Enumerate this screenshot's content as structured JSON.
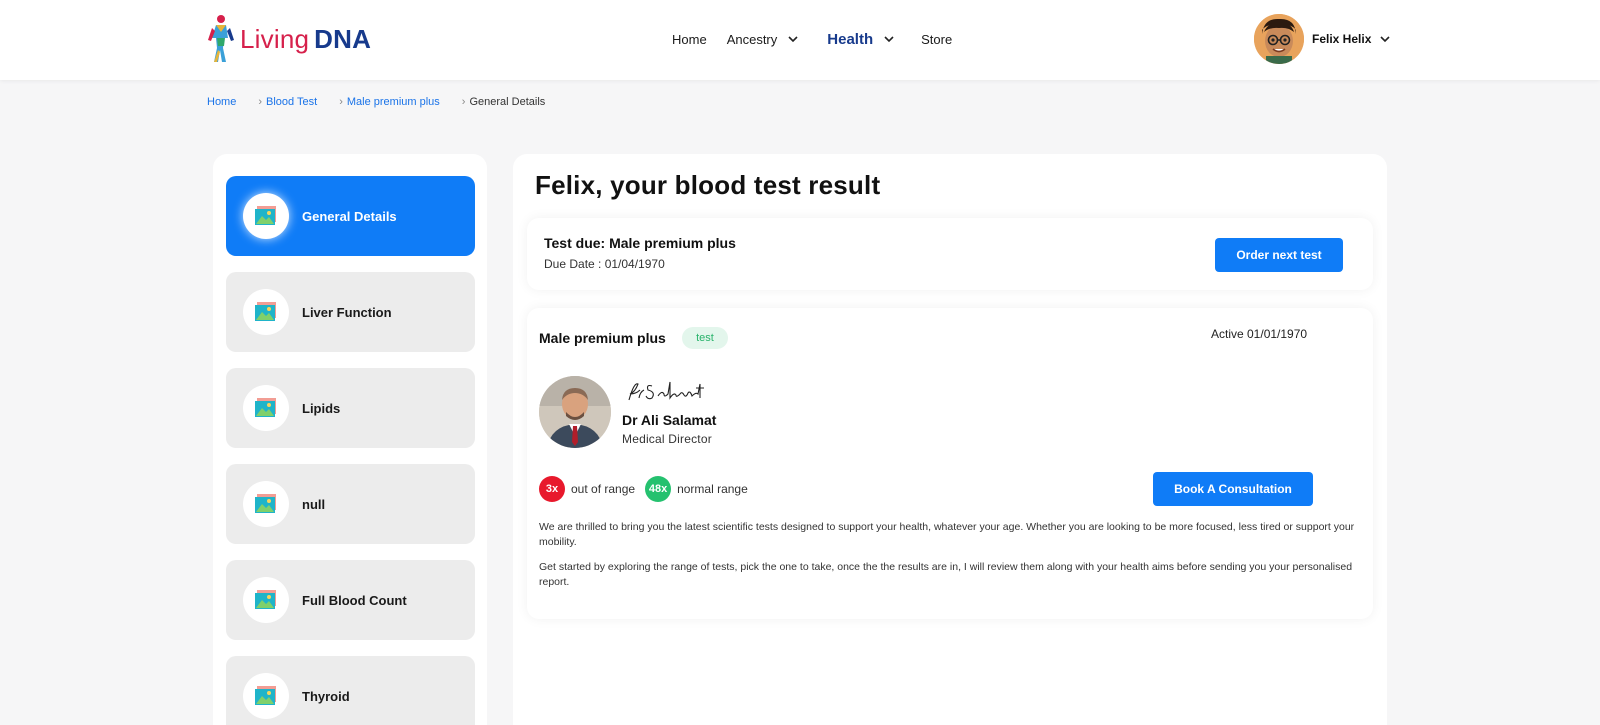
{
  "brand": {
    "name_part1": "Living",
    "name_part2": "DNA"
  },
  "nav": {
    "home": "Home",
    "ancestry": "Ancestry",
    "health": "Health",
    "store": "Store"
  },
  "user": {
    "name": "Felix Helix"
  },
  "breadcrumb": [
    "Home",
    "Blood Test",
    "Male premium plus",
    "General Details"
  ],
  "sidebar": {
    "items": [
      {
        "label": "General Details",
        "active": true
      },
      {
        "label": "Liver Function"
      },
      {
        "label": "Lipids"
      },
      {
        "label": "null"
      },
      {
        "label": "Full Blood Count"
      },
      {
        "label": "Thyroid"
      }
    ]
  },
  "main": {
    "title": "Felix, your blood test result",
    "due": {
      "title": "Test due: Male premium plus",
      "date": "Due Date : 01/04/1970",
      "button": "Order next test"
    },
    "result": {
      "plan": "Male premium plus",
      "badge": "test",
      "active": "Active 01/01/1970",
      "doctor_name": "Dr Ali Salamat",
      "doctor_role": "Medical Director",
      "out_of_range_count": "3x",
      "out_of_range_label": "out of range",
      "normal_range_count": "48x",
      "normal_range_label": "normal range",
      "consult_button": "Book A Consultation",
      "paragraph1": "We are thrilled to bring you the latest scientific tests designed to support your health, whatever your age. Whether you are looking to be more focused, less tired or support your mobility.",
      "paragraph2": "Get started by exploring the range of tests, pick the one to take, once the the results are in, I will review them along with your health aims before sending you your personalised report."
    }
  },
  "colors": {
    "primary": "#0f7cf7",
    "brand_red": "#d6204b",
    "brand_navy": "#173a8c",
    "out_of_range": "#e8192c",
    "normal_range": "#25c16f"
  }
}
